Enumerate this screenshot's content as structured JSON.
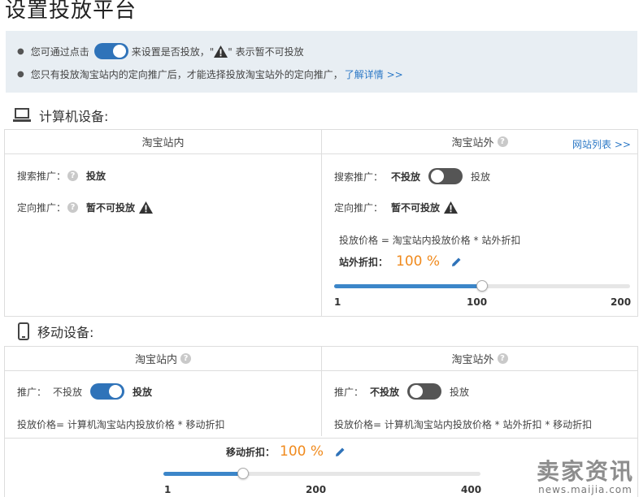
{
  "page_title": "设置投放平台",
  "notice": {
    "line1_before": "您可通过点击",
    "line1_after": "来设置是否投放，\"",
    "line1_end": "\" 表示暂不可投放",
    "line2_text": "您只有投放淘宝站内的定向推广后，才能选择投放淘宝站外的定向推广，",
    "line2_link": "了解详情 >>"
  },
  "computer": {
    "title": "计算机设备:",
    "col_inside": "淘宝站内",
    "col_outside": "淘宝站外",
    "site_list_link": "网站列表 >>",
    "inside": {
      "search_label": "搜索推广：",
      "search_value": "投放",
      "target_label": "定向推广：",
      "target_value": "暂不可投放"
    },
    "outside": {
      "search_label": "搜索推广：",
      "search_off": "不投放",
      "search_on": "投放",
      "target_label": "定向推广：",
      "target_value": "暂不可投放",
      "price_formula": "投放价格 = 淘宝站内投放价格 * 站外折扣",
      "discount_label": "站外折扣：",
      "discount_value": "100 %",
      "slider": {
        "min": "1",
        "mid": "100",
        "max": "200",
        "value": 100,
        "fraction": 0.5
      }
    }
  },
  "mobile": {
    "title": "移动设备:",
    "col_inside": "淘宝站内",
    "col_outside": "淘宝站外",
    "inside": {
      "promo_label": "推广：",
      "off_label": "不投放",
      "on_label": "投放",
      "price_formula": "投放价格= 计算机淘宝站内投放价格 * 移动折扣"
    },
    "outside": {
      "promo_label": "推广：",
      "off_label": "不投放",
      "on_label": "投放",
      "price_formula": "投放价格= 计算机淘宝站内投放价格 * 站外折扣 * 移动折扣"
    },
    "discount_label": "移动折扣：",
    "discount_value": "100 %",
    "slider": {
      "min": "1",
      "mid": "200",
      "max": "400",
      "value": 100,
      "fraction": 0.25
    }
  },
  "watermark": {
    "main": "卖家资讯",
    "sub": "news.maijia.com"
  },
  "colors": {
    "accent": "#2f73b9",
    "orange": "#f08a1d",
    "notice_bg": "#e8eef3"
  }
}
